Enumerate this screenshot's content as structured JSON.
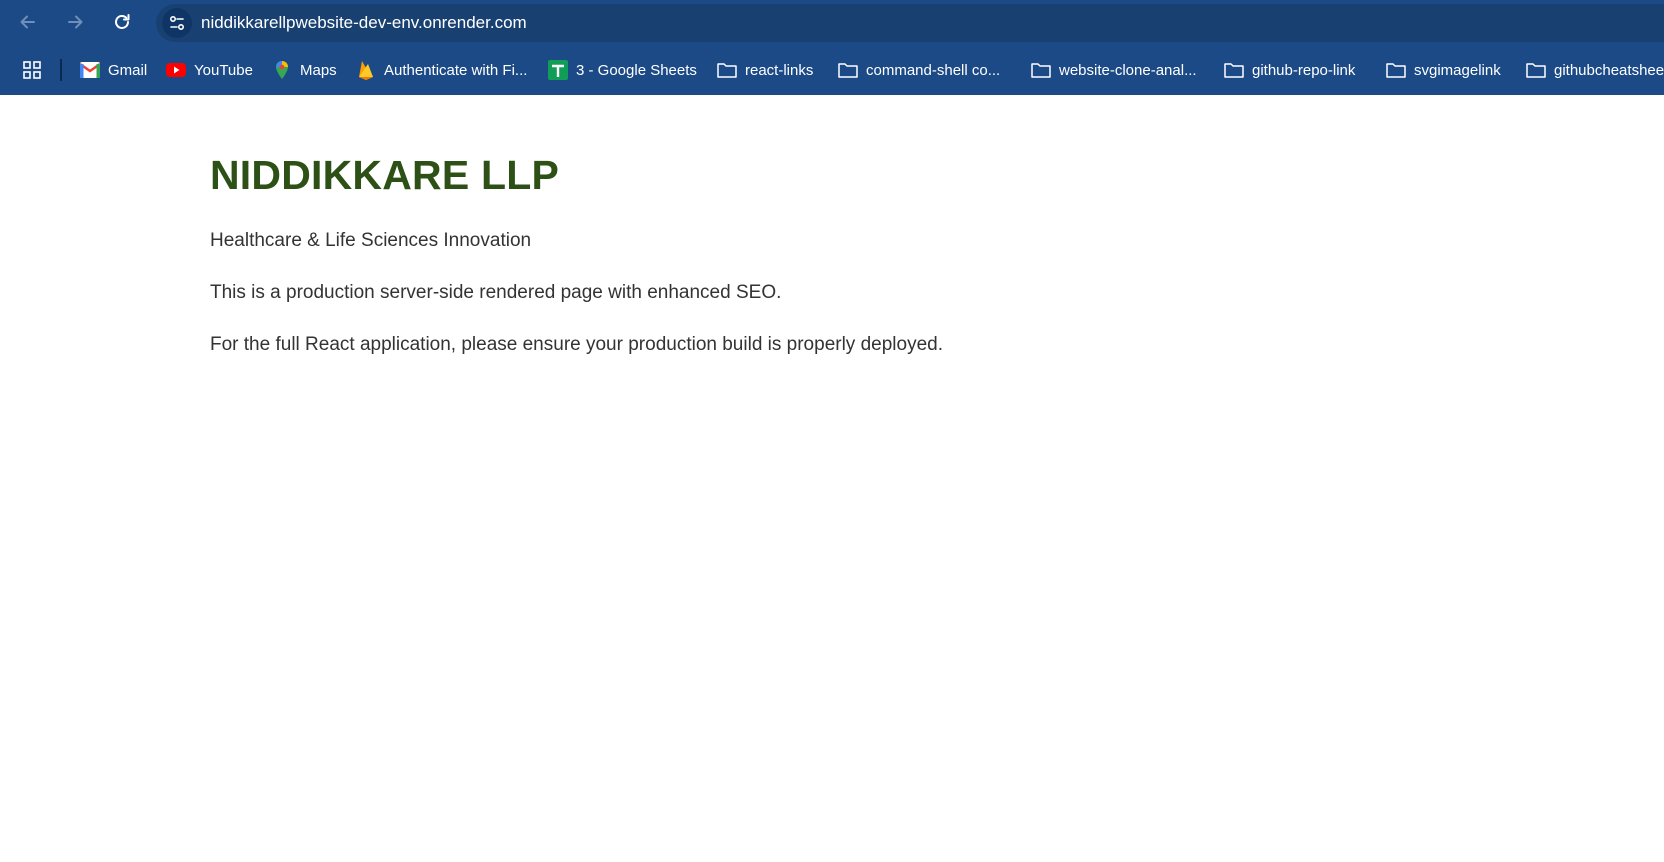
{
  "browser": {
    "url": "niddikkarellpwebsite-dev-env.onrender.com",
    "accent_color": "#1b4a86"
  },
  "bookmarks": [
    {
      "label": "Gmail",
      "icon": "gmail-icon"
    },
    {
      "label": "YouTube",
      "icon": "youtube-icon"
    },
    {
      "label": "Maps",
      "icon": "maps-icon"
    },
    {
      "label": "Authenticate with Fi...",
      "icon": "firebase-icon"
    },
    {
      "label": "3 - Google Sheets",
      "icon": "sheets-icon"
    },
    {
      "label": "react-links",
      "icon": "folder-icon"
    },
    {
      "label": "command-shell co...",
      "icon": "folder-icon"
    },
    {
      "label": "website-clone-anal...",
      "icon": "folder-icon"
    },
    {
      "label": "github-repo-link",
      "icon": "folder-icon"
    },
    {
      "label": "svgimagelink",
      "icon": "folder-icon"
    },
    {
      "label": "githubcheatshee",
      "icon": "folder-icon"
    }
  ],
  "page": {
    "title": "NIDDIKKARE LLP",
    "subtitle": "Healthcare & Life Sciences Innovation",
    "paragraph1": "This is a production server-side rendered page with enhanced SEO.",
    "paragraph2": "For the full React application, please ensure your production build is properly deployed.",
    "title_color": "#2d5016"
  }
}
